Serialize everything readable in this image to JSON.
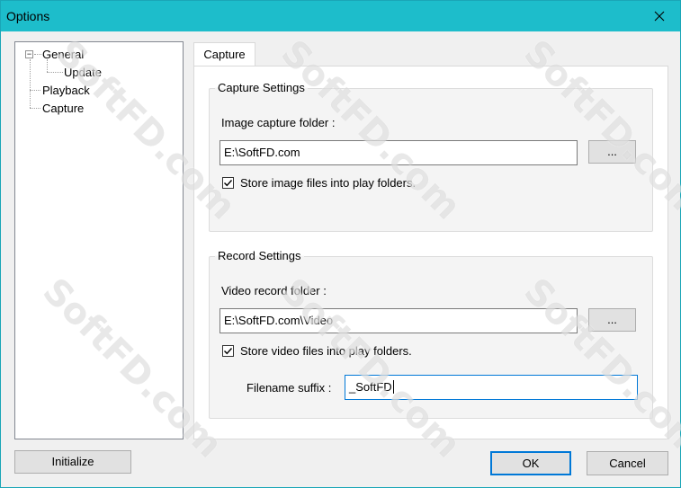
{
  "window": {
    "title": "Options"
  },
  "tree": {
    "items": [
      {
        "label": "General",
        "expander": "⊟"
      },
      {
        "label": "Update"
      },
      {
        "label": "Playback"
      },
      {
        "label": "Capture"
      }
    ]
  },
  "tabs": [
    {
      "label": "Capture"
    }
  ],
  "capture_settings": {
    "title": "Capture Settings",
    "folder_label": "Image capture folder :",
    "folder_value": "E:\\SoftFD.com",
    "browse_label": "...",
    "store_label": "Store image files into play folders.",
    "store_checked": true
  },
  "record_settings": {
    "title": "Record Settings",
    "folder_label": "Video record folder :",
    "folder_value": "E:\\SoftFD.com\\Video",
    "browse_label": "...",
    "store_label": "Store video files into play folders.",
    "store_checked": true,
    "suffix_label": "Filename suffix :",
    "suffix_value": "_SoftFD"
  },
  "buttons": {
    "initialize": "Initialize",
    "ok": "OK",
    "cancel": "Cancel"
  },
  "watermark": "SoftFD.com",
  "colors": {
    "titlebar": "#1dbdcb",
    "focus": "#0078d7"
  }
}
